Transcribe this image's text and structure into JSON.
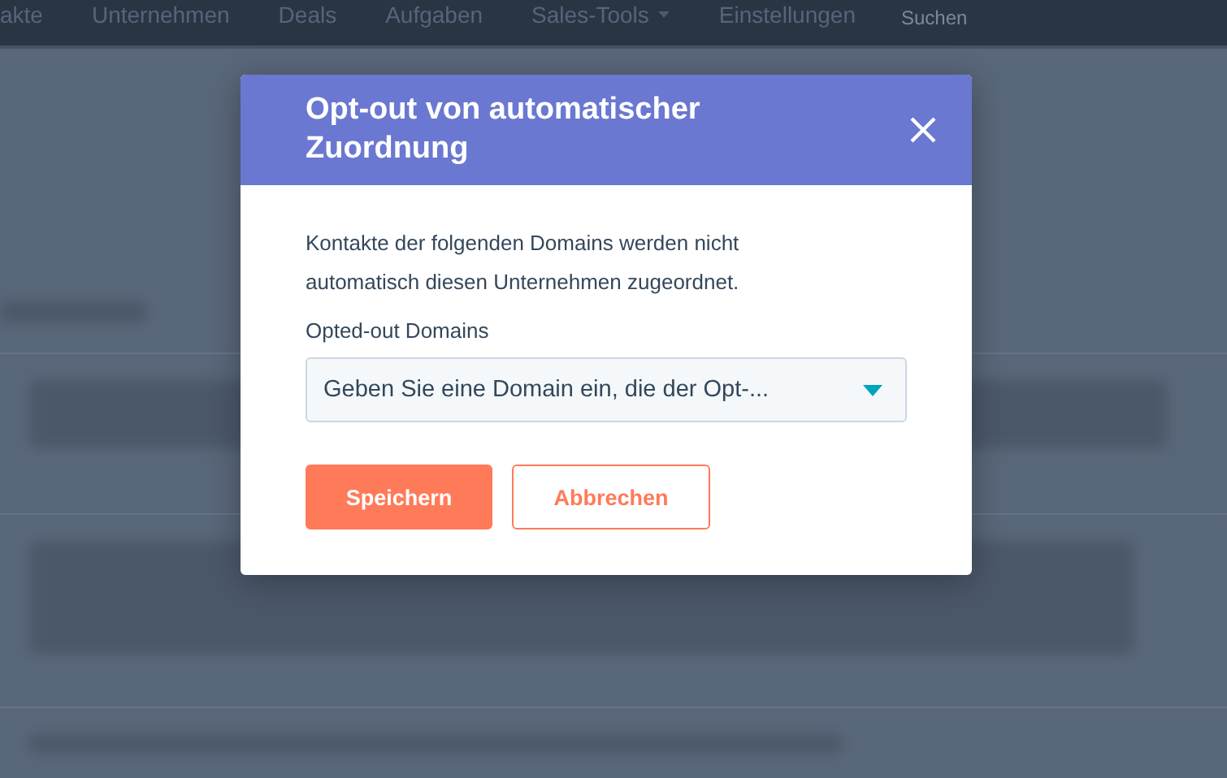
{
  "nav": {
    "items": [
      {
        "label": "akte",
        "has_menu": false
      },
      {
        "label": "Unternehmen",
        "has_menu": false
      },
      {
        "label": "Deals",
        "has_menu": false
      },
      {
        "label": "Aufgaben",
        "has_menu": false
      },
      {
        "label": "Sales-Tools",
        "has_menu": true
      },
      {
        "label": "Einstellungen",
        "has_menu": false
      }
    ],
    "search": {
      "placeholder": "Suchen"
    }
  },
  "dialog": {
    "title": "Opt-out von automatischer Zuordnung",
    "description": "Kontakte der folgenden Domains werden nicht automatisch diesen Unternehmen zugeordnet.",
    "field_label": "Opted-out Domains",
    "select": {
      "placeholder": "Geben Sie eine Domain ein, die der Opt-..."
    },
    "buttons": [
      {
        "label": "Speichern",
        "kind": "primary"
      },
      {
        "label": "Abbrechen",
        "kind": "secondary"
      }
    ]
  }
}
